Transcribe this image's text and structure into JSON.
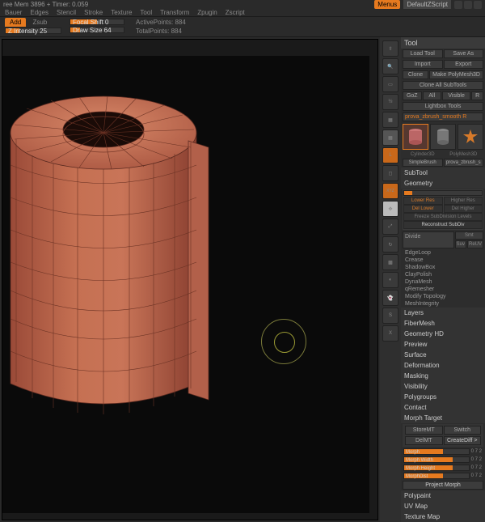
{
  "title": "ree Mem 3896 + Timer: 0.059",
  "header": {
    "menus_label": "Menus",
    "script_label": "DefaultZScript"
  },
  "menubar": [
    "Bauer",
    "Edges",
    "Stencil",
    "Stroke",
    "Texture",
    "Tool",
    "Transform",
    "Zpugin",
    "Zscript"
  ],
  "topbar": {
    "tab_add": "Add",
    "tab_zsub": "Zsub",
    "focal": "Focal Shift 0",
    "intensity_label": "Z Intensity 25",
    "drawsize_label": "Draw Size 64",
    "active_points": "ActivePoints: 884",
    "total_points": "TotalPoints: 884"
  },
  "midstrip": {
    "labels": [
      "Scroll",
      "Actual",
      "AAHalf",
      "Persp",
      "Local",
      "Frame",
      "XYZ",
      "M",
      "Xpose",
      "Trans"
    ]
  },
  "tool": {
    "header": "Tool",
    "buttons": {
      "load": "Load Tool",
      "saveas": "Save As",
      "import": "Import",
      "export": "Export",
      "clone": "Clone",
      "make": "Make PolyMesh3D",
      "cloneall": "Clone All SubTools",
      "gol": "GoZ",
      "all": "All",
      "visible": "Visible",
      "r": "R",
      "lightbox": "Lightbox Tools"
    },
    "current": "prova_zbrush_smooth R",
    "thumb1_label": "Cylinder3D",
    "thumb2_label": "PolyMesh3D",
    "thumb_under1": "SimpleBrush",
    "thumb_under2": "prova_zbrush_s"
  },
  "subtool": {
    "header": "SubTool"
  },
  "geometry": {
    "header": "Geometry",
    "lower": "Lower Res",
    "higher": "Higher Res",
    "dellower": "Del Lower",
    "delhigher": "Del Higher",
    "freeze": "Freeze SubDivision Levels",
    "reconstruct": "Reconstruct SubDiv",
    "divide": "Divide",
    "smt": "Smt",
    "suv": "Suv",
    "rstr": "ReUV",
    "items": [
      "EdgeLoop",
      "Crease",
      "ShadowBox",
      "ClayPolish",
      "DynaMesh",
      "qRemesher",
      "Modify Topology",
      "MeshIntegrity"
    ]
  },
  "sections": [
    "Layers",
    "FiberMesh",
    "Geometry HD",
    "Preview",
    "Surface",
    "Deformation",
    "Masking",
    "Visibility",
    "Polygroups",
    "Contact"
  ],
  "morph": {
    "header": "Morph Target",
    "store": "StoreMT",
    "switch": "Switch",
    "delmt": "DelMT",
    "creatediff": "CreateDiff >",
    "sliders": [
      {
        "label": "Morph",
        "val": "0 7 2"
      },
      {
        "label": "Morph Width",
        "val": "0 7 2"
      },
      {
        "label": "Morph Height",
        "val": "0 7 2"
      },
      {
        "label": "MorphDist",
        "val": "0 7 2"
      }
    ],
    "project": "Project Morph"
  },
  "bottom_sections": [
    "Polypaint",
    "UV Map",
    "Texture Map"
  ]
}
